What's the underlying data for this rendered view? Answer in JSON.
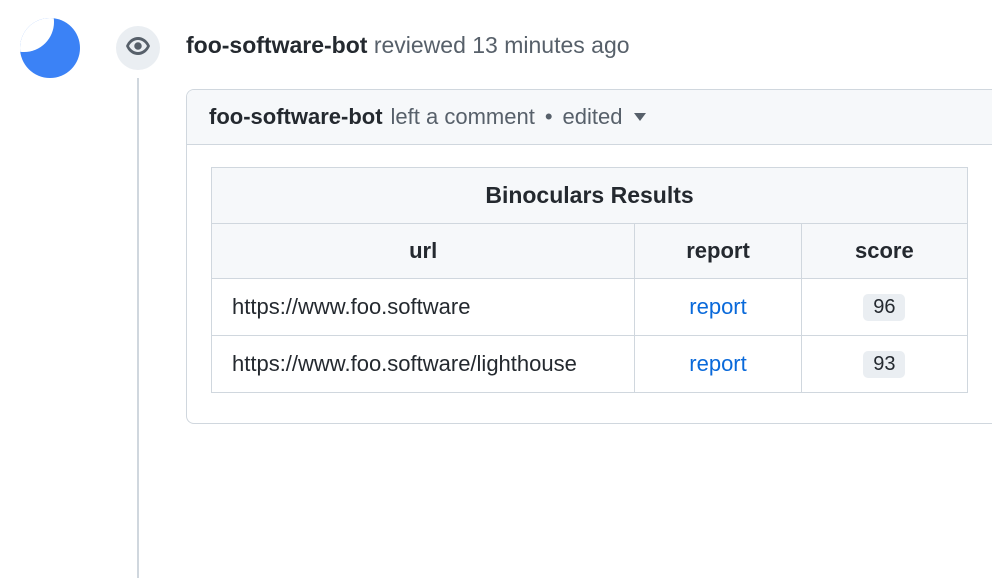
{
  "review": {
    "author": "foo-software-bot",
    "action_text": "reviewed",
    "time_text": "13 minutes ago"
  },
  "comment": {
    "author": "foo-software-bot",
    "meta_text": "left a comment",
    "edited_text": "edited"
  },
  "table": {
    "title": "Binoculars Results",
    "headers": {
      "url": "url",
      "report": "report",
      "score": "score"
    },
    "rows": [
      {
        "url": "https://www.foo.software",
        "report_label": "report",
        "score": "96"
      },
      {
        "url": "https://www.foo.software/lighthouse",
        "report_label": "report",
        "score": "93"
      }
    ]
  }
}
